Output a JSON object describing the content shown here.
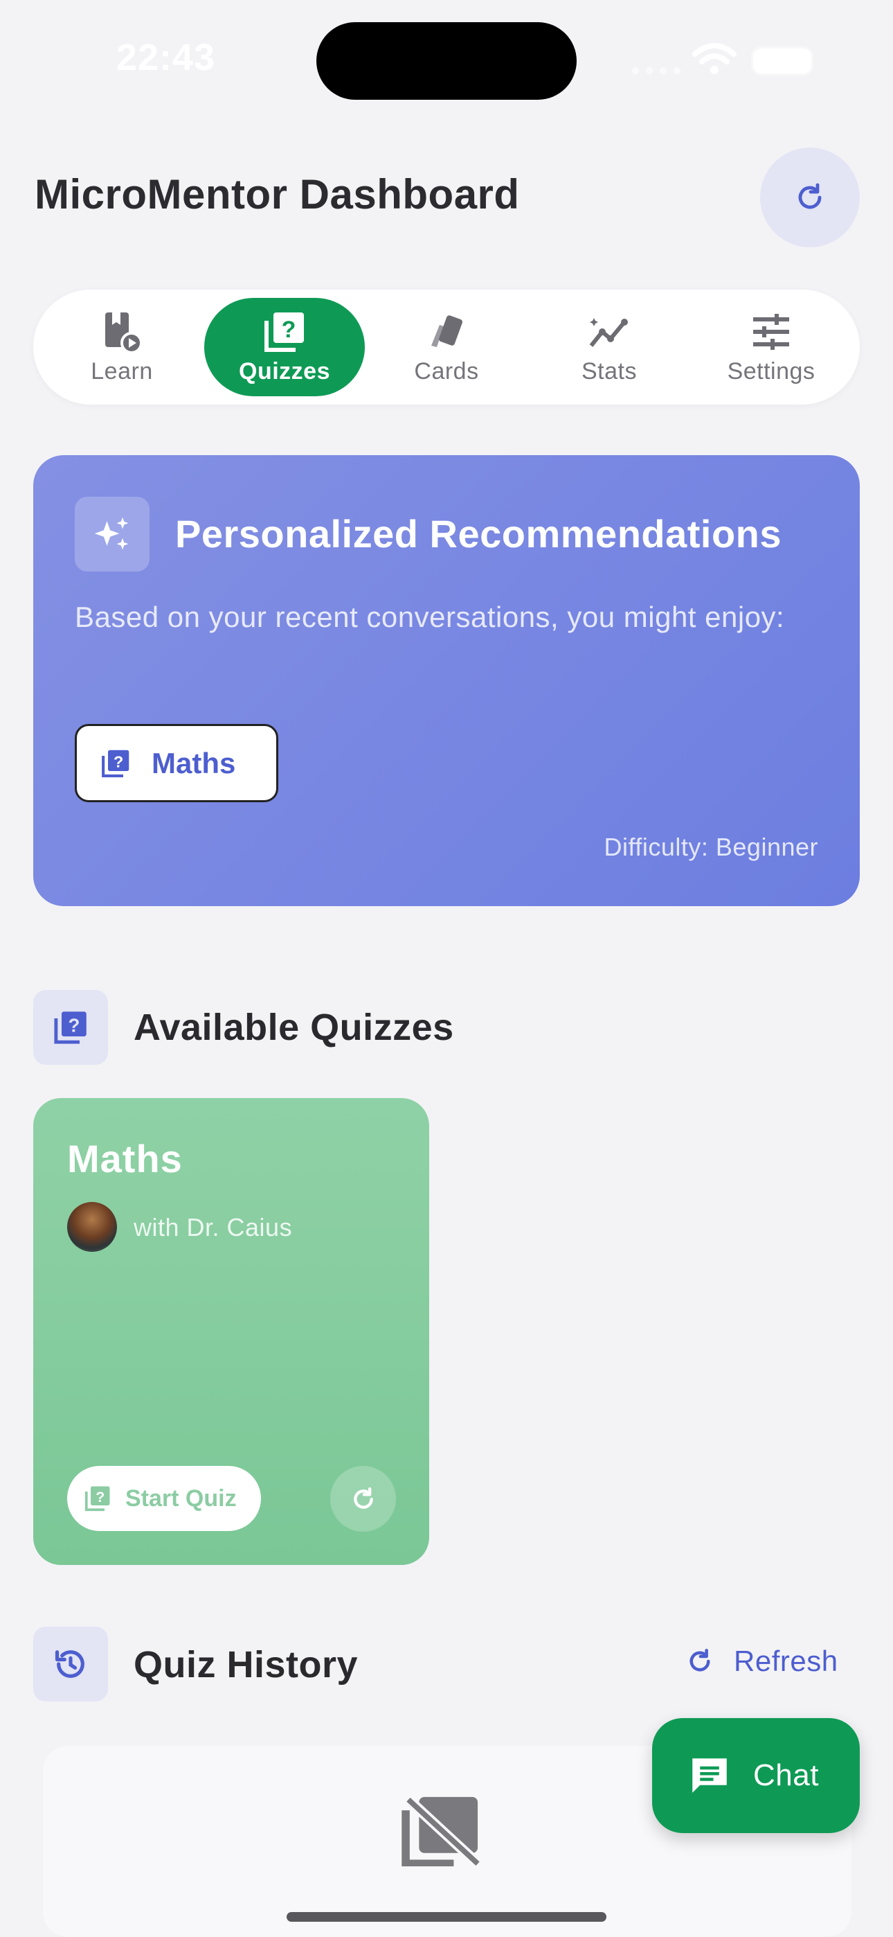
{
  "status_bar": {
    "time": "22:43"
  },
  "header": {
    "title": "MicroMentor Dashboard",
    "refresh_icon": "refresh-icon"
  },
  "tabs": [
    {
      "label": "Learn",
      "icon": "book-video-icon",
      "active": false
    },
    {
      "label": "Quizzes",
      "icon": "quiz-icon",
      "active": true
    },
    {
      "label": "Cards",
      "icon": "cards-icon",
      "active": false
    },
    {
      "label": "Stats",
      "icon": "chart-line-icon",
      "active": false
    },
    {
      "label": "Settings",
      "icon": "sliders-icon",
      "active": false
    }
  ],
  "recommendations": {
    "title": "Personalized Recommendations",
    "subtitle": "Based on your recent conversations, you might enjoy:",
    "chip_label": "Maths",
    "difficulty": "Difficulty: Beginner"
  },
  "available_quizzes": {
    "title": "Available Quizzes",
    "cards": [
      {
        "name": "Maths",
        "mentor": "with Dr. Caius",
        "start_label": "Start Quiz"
      }
    ]
  },
  "quiz_history": {
    "title": "Quiz History",
    "refresh_label": "Refresh"
  },
  "chat": {
    "label": "Chat"
  },
  "colors": {
    "accent": "#0e9a55",
    "primary": "#4d5ecf",
    "background": "#f3f3f6",
    "card_green": "#82ca9b",
    "reco_gradient_start": "#8490e3",
    "reco_gradient_end": "#6c7ee0"
  }
}
